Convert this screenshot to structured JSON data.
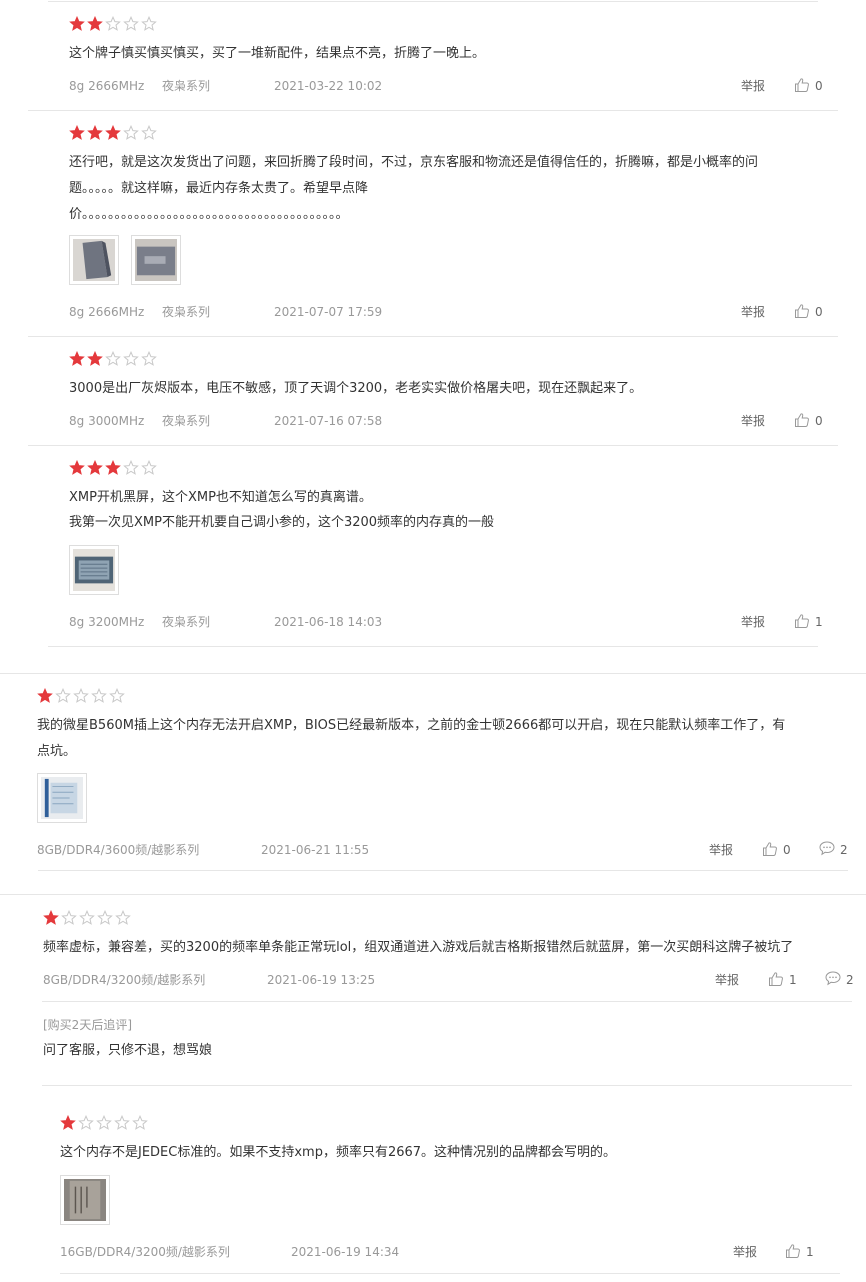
{
  "star_colors": {
    "filled": "#e4393c",
    "empty": "#c8c8c8"
  },
  "report_label": "举报",
  "reviews": [
    {
      "rating": 2,
      "lines": [
        "这个牌子慎买慎买慎买，买了一堆新配件，结果点不亮，折腾了一晚上。"
      ],
      "spec": "8g 2666MHz",
      "series": "夜枭系列",
      "date": "2021-03-22 10:02",
      "likes": "0"
    },
    {
      "rating": 3,
      "lines": [
        "还行吧，就是这次发货出了问题，来回折腾了段时间，不过，京东客服和物流还是值得信任的，折腾嘛，都是小概率的问",
        "题。。。。。就这样嘛，最近内存条太贵了。希望早点降",
        "价。。。。。。。。。。。。。。。。。。。。。。。。。。。。。。。。。。。。。。。。"
      ],
      "photos": 2,
      "spec": "8g 2666MHz",
      "series": "夜枭系列",
      "date": "2021-07-07 17:59",
      "likes": "0"
    },
    {
      "rating": 2,
      "lines": [
        "3000是出厂灰烬版本，电压不敏感，顶了天调个3200，老老实实做价格屠夫吧，现在还飘起来了。"
      ],
      "spec": "8g 3000MHz",
      "series": "夜枭系列",
      "date": "2021-07-16 07:58",
      "likes": "0"
    },
    {
      "rating": 3,
      "lines": [
        "XMP开机黑屏，这个XMP也不知道怎么写的真离谱。",
        "我第一次见XMP不能开机要自己调小参的，这个3200频率的内存真的一般"
      ],
      "photos": 1,
      "spec": "8g 3200MHz",
      "series": "夜枭系列",
      "date": "2021-06-18 14:03",
      "likes": "1"
    },
    {
      "rating": 1,
      "lines": [
        "我的微星B560M插上这个内存无法开启XMP，BIOS已经最新版本，之前的金士顿2666都可以开启，现在只能默认频率工作了，有",
        "点坑。"
      ],
      "photos": 1,
      "spec": "8GB/DDR4/3600频/越影系列",
      "date": "2021-06-21 11:55",
      "likes": "0",
      "comments": "2"
    },
    {
      "rating": 1,
      "lines": [
        "频率虚标，兼容差，买的3200的频率单条能正常玩lol，组双通道进入游戏后就吉格斯报错然后就蓝屏，第一次买朗科这牌子被坑了"
      ],
      "spec": "8GB/DDR4/3200频/越影系列",
      "date": "2021-06-19 13:25",
      "likes": "1",
      "comments": "2",
      "followup_tag": "[购买2天后追评]",
      "followup_text": "问了客服，只修不退，想骂娘"
    },
    {
      "rating": 1,
      "lines": [
        "这个内存不是JEDEC标准的。如果不支持xmp，频率只有2667。这种情况别的品牌都会写明的。"
      ],
      "photos": 1,
      "spec": "16GB/DDR4/3200频/越影系列",
      "date": "2021-06-19 14:34",
      "likes": "1"
    }
  ]
}
